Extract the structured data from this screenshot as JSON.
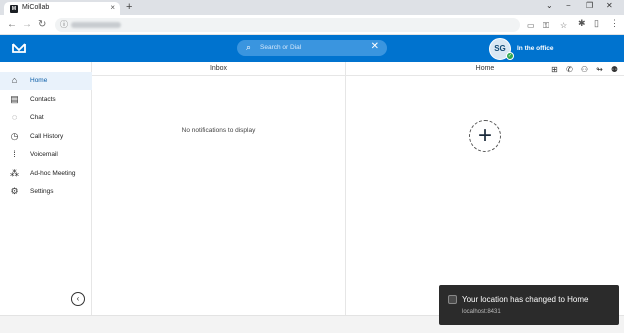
{
  "browser": {
    "tab_title": "MiCollab",
    "tab_close": "×",
    "new_tab": "+",
    "back": "←",
    "forward": "→",
    "reload": "C",
    "info": "ⓘ",
    "window_controls": [
      "−",
      "❐",
      "✕"
    ]
  },
  "header": {
    "search_placeholder": "Search or Dial",
    "avatar_initials": "SG",
    "status": "In the office",
    "brand_color": "#0073cf"
  },
  "sidebar": {
    "items": [
      {
        "label": "Home",
        "icon": "home-icon",
        "active": true
      },
      {
        "label": "Contacts",
        "icon": "contacts-icon",
        "active": false
      },
      {
        "label": "Chat",
        "icon": "chat-icon",
        "active": false
      },
      {
        "label": "Call History",
        "icon": "clock-icon",
        "active": false
      },
      {
        "label": "Voicemail",
        "icon": "voicemail-icon",
        "active": false
      },
      {
        "label": "Ad-hoc Meeting",
        "icon": "meeting-icon",
        "active": false
      },
      {
        "label": "Settings",
        "icon": "gear-icon",
        "active": false
      }
    ]
  },
  "inbox": {
    "title": "Inbox",
    "empty_message": "No notifications to display"
  },
  "home": {
    "title": "Home",
    "add_symbol": "+"
  },
  "toast": {
    "title": "Your location has changed to Home",
    "source": "localhost:8431"
  }
}
